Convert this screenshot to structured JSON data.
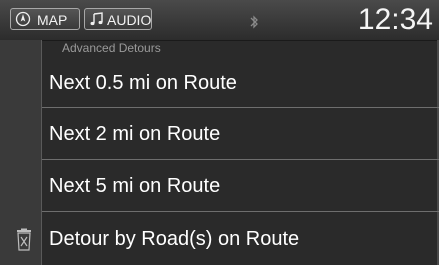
{
  "header": {
    "map_label": "MAP",
    "audio_label": "AUDIO",
    "clock": "12:34"
  },
  "section": {
    "title": "Advanced Detours"
  },
  "menu": {
    "items": [
      {
        "label": "Next 0.5 mi on Route"
      },
      {
        "label": "Next 2 mi on Route"
      },
      {
        "label": "Next 5 mi on Route"
      },
      {
        "label": "Detour by Road(s) on Route"
      }
    ]
  },
  "icons": {
    "map": "compass-icon",
    "audio": "music-note-icon",
    "bluetooth": "bluetooth-icon",
    "delete": "trash-icon"
  }
}
